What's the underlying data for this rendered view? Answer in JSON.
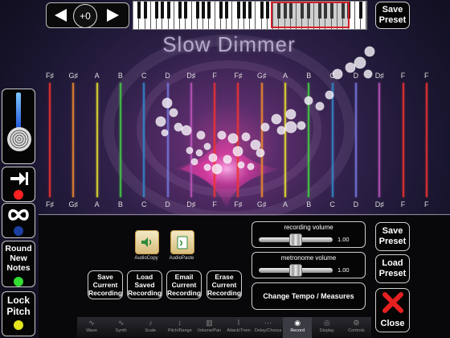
{
  "transpose": {
    "value": "+0",
    "left_icon": "left-arrow-icon",
    "right_icon": "right-arrow-icon"
  },
  "title": "Slow Dimmer",
  "notes_top": [
    "F♯",
    "G♯",
    "A",
    "B",
    "C",
    "D",
    "D♯",
    "F",
    "F♯",
    "G♯",
    "A",
    "B",
    "C",
    "D",
    "D♯",
    "F",
    "F"
  ],
  "notes_bottom": [
    "F♯",
    "G♯",
    "A",
    "B",
    "C",
    "D",
    "D♯",
    "F",
    "F♯",
    "G♯",
    "A",
    "B",
    "C",
    "D",
    "D♯",
    "F",
    "F"
  ],
  "string_colors": [
    "#e33",
    "#ee8830",
    "#e8e030",
    "#4c4",
    "#38c",
    "#77d",
    "#b5b",
    "#e33",
    "#e33",
    "#ee8830",
    "#e8e030",
    "#4c4",
    "#38c",
    "#77d",
    "#b5b",
    "#e33",
    "#e33"
  ],
  "left_panel": {
    "forward_icon": "arrow-to-bar-icon",
    "loop_icon": "infinity-icon",
    "round_label": "Round New Notes",
    "lock_label": "Lock Pitch",
    "colors": {
      "red": "#ff2020",
      "blue": "#1a3fa0",
      "green": "#33dd33",
      "yellow": "#e4e420"
    }
  },
  "audio": {
    "copy_label": "AudioCopy",
    "paste_label": "AudioPaste"
  },
  "recording_buttons": [
    {
      "label": "Save Current Recording"
    },
    {
      "label": "Load Saved Recording"
    },
    {
      "label": "Email Current Recording"
    },
    {
      "label": "Erase Current Recording"
    }
  ],
  "recording_volume": {
    "label": "recording volume",
    "value": "1.00",
    "level": 0.5
  },
  "metronome_volume": {
    "label": "metronome volume",
    "value": "1.00",
    "level": 0.5
  },
  "tempo_label": "Change Tempo / Measures",
  "save_preset": "Save Preset",
  "save_preset_bottom": "Save Preset",
  "load_preset": "Load Preset",
  "close_label": "Close",
  "tabs": [
    "Wave",
    "Synth",
    "Scale",
    "Pitch/Range",
    "Volume/Pan",
    "Attack/Trem",
    "Delay/Chorus",
    "Record",
    "Display",
    "Controls"
  ],
  "active_tab": "Record"
}
